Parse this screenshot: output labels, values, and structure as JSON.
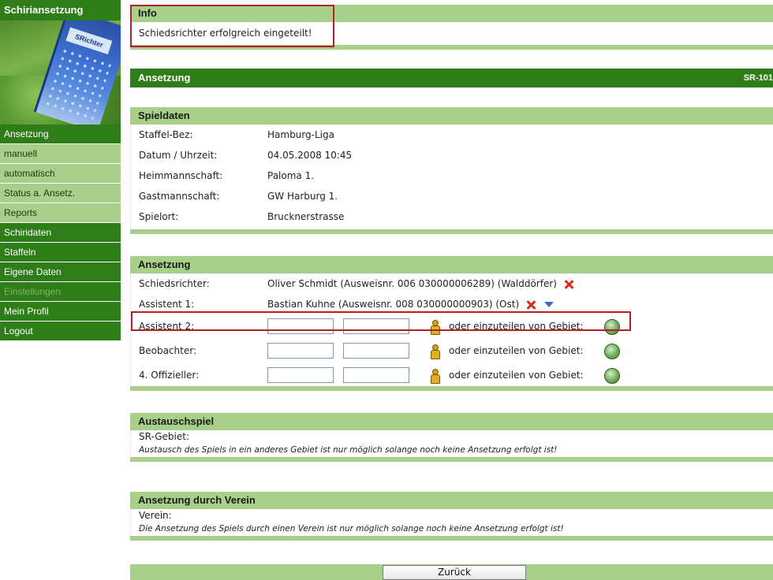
{
  "sidebar": {
    "title": "Schiriansetzung",
    "image_label": "SRichter",
    "items": [
      {
        "label": "Ansetzung",
        "style": "dark"
      },
      {
        "label": "manuell",
        "style": "light"
      },
      {
        "label": "automatisch",
        "style": "light"
      },
      {
        "label": "Status a. Ansetz.",
        "style": "light"
      },
      {
        "label": "Reports",
        "style": "light"
      },
      {
        "label": "Schiridaten",
        "style": "dark"
      },
      {
        "label": "Staffeln",
        "style": "dark"
      },
      {
        "label": "Eigene Daten",
        "style": "dark"
      },
      {
        "label": "Einstellungen",
        "style": "disabled"
      },
      {
        "label": "Mein Profil",
        "style": "dark"
      },
      {
        "label": "Logout",
        "style": "dark"
      }
    ]
  },
  "info": {
    "title": "Info",
    "message": "Schiedsrichter erfolgreich eingeteilt!"
  },
  "ansetzung_bar": {
    "title": "Ansetzung",
    "code": "SR-101"
  },
  "spieldaten": {
    "title": "Spieldaten",
    "rows": [
      {
        "label": "Staffel-Bez:",
        "value": "Hamburg-Liga"
      },
      {
        "label": "Datum / Uhrzeit:",
        "value": "04.05.2008 10:45"
      },
      {
        "label": "Heimmannschaft:",
        "value": "Paloma 1."
      },
      {
        "label": "Gastmannschaft:",
        "value": "GW Harburg 1."
      },
      {
        "label": "Spielort:",
        "value": "Brucknerstrasse"
      }
    ]
  },
  "ansetzung": {
    "title": "Ansetzung",
    "schiedsrichter": {
      "label": "Schiedsrichter:",
      "value": "Oliver Schmidt (Ausweisnr. 006 030000006289) (Walddörfer)"
    },
    "assistent1": {
      "label": "Assistent 1:",
      "value": "Bastian Kuhne (Ausweisnr. 008 030000000903) (Ost)"
    },
    "open_slots": [
      {
        "label": "Assistent 2:",
        "input1": "",
        "input2": ""
      },
      {
        "label": "Beobachter:",
        "input1": "",
        "input2": ""
      },
      {
        "label": "4. Offizieller:",
        "input1": "",
        "input2": ""
      }
    ],
    "oder_text": "oder einzuteilen von Gebiet:"
  },
  "austausch": {
    "title": "Austauschspiel",
    "line1": "SR-Gebiet:",
    "note": "Austausch des Spiels in ein anderes Gebiet ist nur möglich solange noch keine Ansetzung erfolgt ist!"
  },
  "verein": {
    "title": "Ansetzung durch Verein",
    "line1": "Verein:",
    "note": "Die Ansetzung des Spiels durch einen Verein ist nur möglich solange noch keine Ansetzung erfolgt ist!"
  },
  "footer": {
    "back_label": "Zurück"
  },
  "colors": {
    "dark_green": "#2e7d18",
    "light_green": "#a8d08a",
    "highlight_red": "#b22222"
  }
}
